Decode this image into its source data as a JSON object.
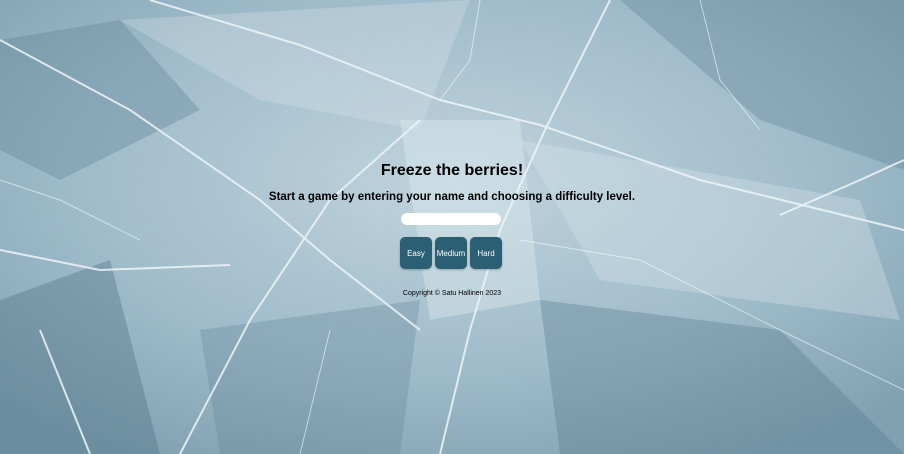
{
  "page": {
    "title": "Freeze the berries!",
    "subtitle": "Start a game by entering your name and choosing a difficulty level.",
    "copyright": "Copyright © Satu Hallinen 2023"
  },
  "name_input": {
    "value": "",
    "placeholder": ""
  },
  "difficulty": {
    "easy_label": "Easy",
    "medium_label": "Medium",
    "hard_label": "Hard"
  },
  "colors": {
    "button_bg": "#2b5f73",
    "button_text": "#ffffff",
    "ice_base": "#8fb0c0"
  }
}
